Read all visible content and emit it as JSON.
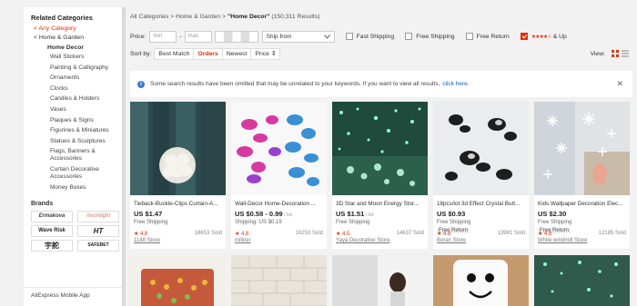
{
  "sidebar": {
    "title": "Related Categories",
    "any_category": "< Any Category",
    "home_garden": "< Home & Garden",
    "home_decor": "Home Decor",
    "items": [
      "Wall Stickers",
      "Painting & Calligraphy",
      "Ornaments",
      "Clocks",
      "Candles & Holders",
      "Vases",
      "Plaques & Signs",
      "Figurines & Miniatures",
      "Statues & Sculptures",
      "Flags, Banners & Accessories",
      "Curtain Decorative Accessories",
      "Money Boxes"
    ],
    "brands_title": "Brands",
    "brands": [
      "Ermakova",
      "moonlight",
      "Wave Risk",
      "HT",
      "宇舵",
      "SAFEBET"
    ],
    "mobile_app": "AliExpress Mobile App"
  },
  "breadcrumb": {
    "all": "All Categories",
    "sep1": ">",
    "home": "Home & Garden",
    "sep2": ">",
    "query": "\"Home Decor\"",
    "count": "(150,311 Results)"
  },
  "filters": {
    "price_label": "Price:",
    "min_placeholder": "min",
    "dash": "-",
    "max_placeholder": "max",
    "ship_from": "Ship from",
    "fast_shipping": "Fast Shipping",
    "free_shipping": "Free Shipping",
    "free_return": "Free Return",
    "stars": "★★★★☆",
    "and_up": "& Up"
  },
  "sort": {
    "label": "Sort by:",
    "best_match": "Best Match",
    "orders": "Orders",
    "newest": "Newest",
    "price": "Price ⇕",
    "view": "View:"
  },
  "notice": {
    "text": "Some search results have been omitted that may be unrelated to your keywords. If you want to view all results,",
    "link": "click here.",
    "close": "✕"
  },
  "products": [
    {
      "title": "Tieback-Buckle-Clips Curtain-A...",
      "price": "US $1.47",
      "lot": "",
      "ship": "Free Shipping",
      "ret": "",
      "rating": "★ 4.8",
      "sold": "18653 Sold",
      "store": "1148 Store"
    },
    {
      "title": "Wall-Decor Home-Decoration ...",
      "price": "US $0.58 - 0.99",
      "lot": " / lot",
      "ship": "Shipping: US $0.19",
      "ret": "",
      "rating": "★ 4.8",
      "sold": "16253 Sold",
      "store": "miliner"
    },
    {
      "title": "3D Star and Moon Energy Stor...",
      "price": "US $1.51",
      "lot": " / lot",
      "ship": "Free Shipping",
      "ret": "",
      "rating": "★ 4.5",
      "sold": "14637 Sold",
      "store": "Yaya Decorative Store"
    },
    {
      "title": "18pcs/lot 3d Effect Crystal Butt...",
      "price": "US $0.93",
      "lot": "",
      "ship": "Free Shipping",
      "ret": "Free Return",
      "rating": "★ 4.8",
      "sold": "13981 Sold",
      "store": "Boran Store"
    },
    {
      "title": "Kids Wallpaper Decoration Elec...",
      "price": "US $2.30",
      "lot": "",
      "ship": "Free Shipping",
      "ret": "Free Return",
      "rating": "★ 4.8",
      "sold": "12185 Sold",
      "store": "White windmill Store"
    }
  ]
}
